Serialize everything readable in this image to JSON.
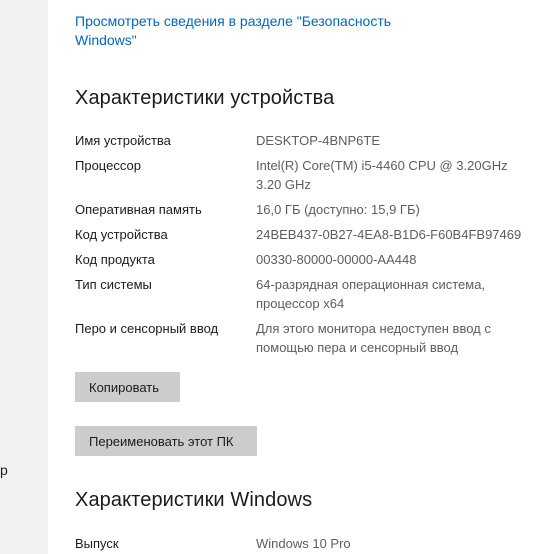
{
  "sidebar": {
    "fragment": "р"
  },
  "security_link": "Просмотреть сведения в разделе \"Безопасность Windows\"",
  "device_specs": {
    "title": "Характеристики устройства",
    "rows": [
      {
        "label": "Имя устройства",
        "value": "DESKTOP-4BNP6TE"
      },
      {
        "label": "Процессор",
        "value": "Intel(R) Core(TM) i5-4460  CPU @ 3.20GHz 3.20 GHz"
      },
      {
        "label": "Оперативная память",
        "value": "16,0 ГБ (доступно: 15,9 ГБ)"
      },
      {
        "label": "Код устройства",
        "value": "24BEB437-0B27-4EA8-B1D6-F60B4FB97469"
      },
      {
        "label": "Код продукта",
        "value": "00330-80000-00000-AA448"
      },
      {
        "label": "Тип системы",
        "value": "64-разрядная операционная система, процессор x64"
      },
      {
        "label": "Перо и сенсорный ввод",
        "value": "Для этого монитора недоступен ввод с помощью пера и сенсорный ввод"
      }
    ],
    "copy_button": "Копировать",
    "rename_button": "Переименовать этот ПК"
  },
  "windows_specs": {
    "title": "Характеристики Windows",
    "rows": [
      {
        "label": "Выпуск",
        "value": "Windows 10 Pro"
      }
    ]
  }
}
